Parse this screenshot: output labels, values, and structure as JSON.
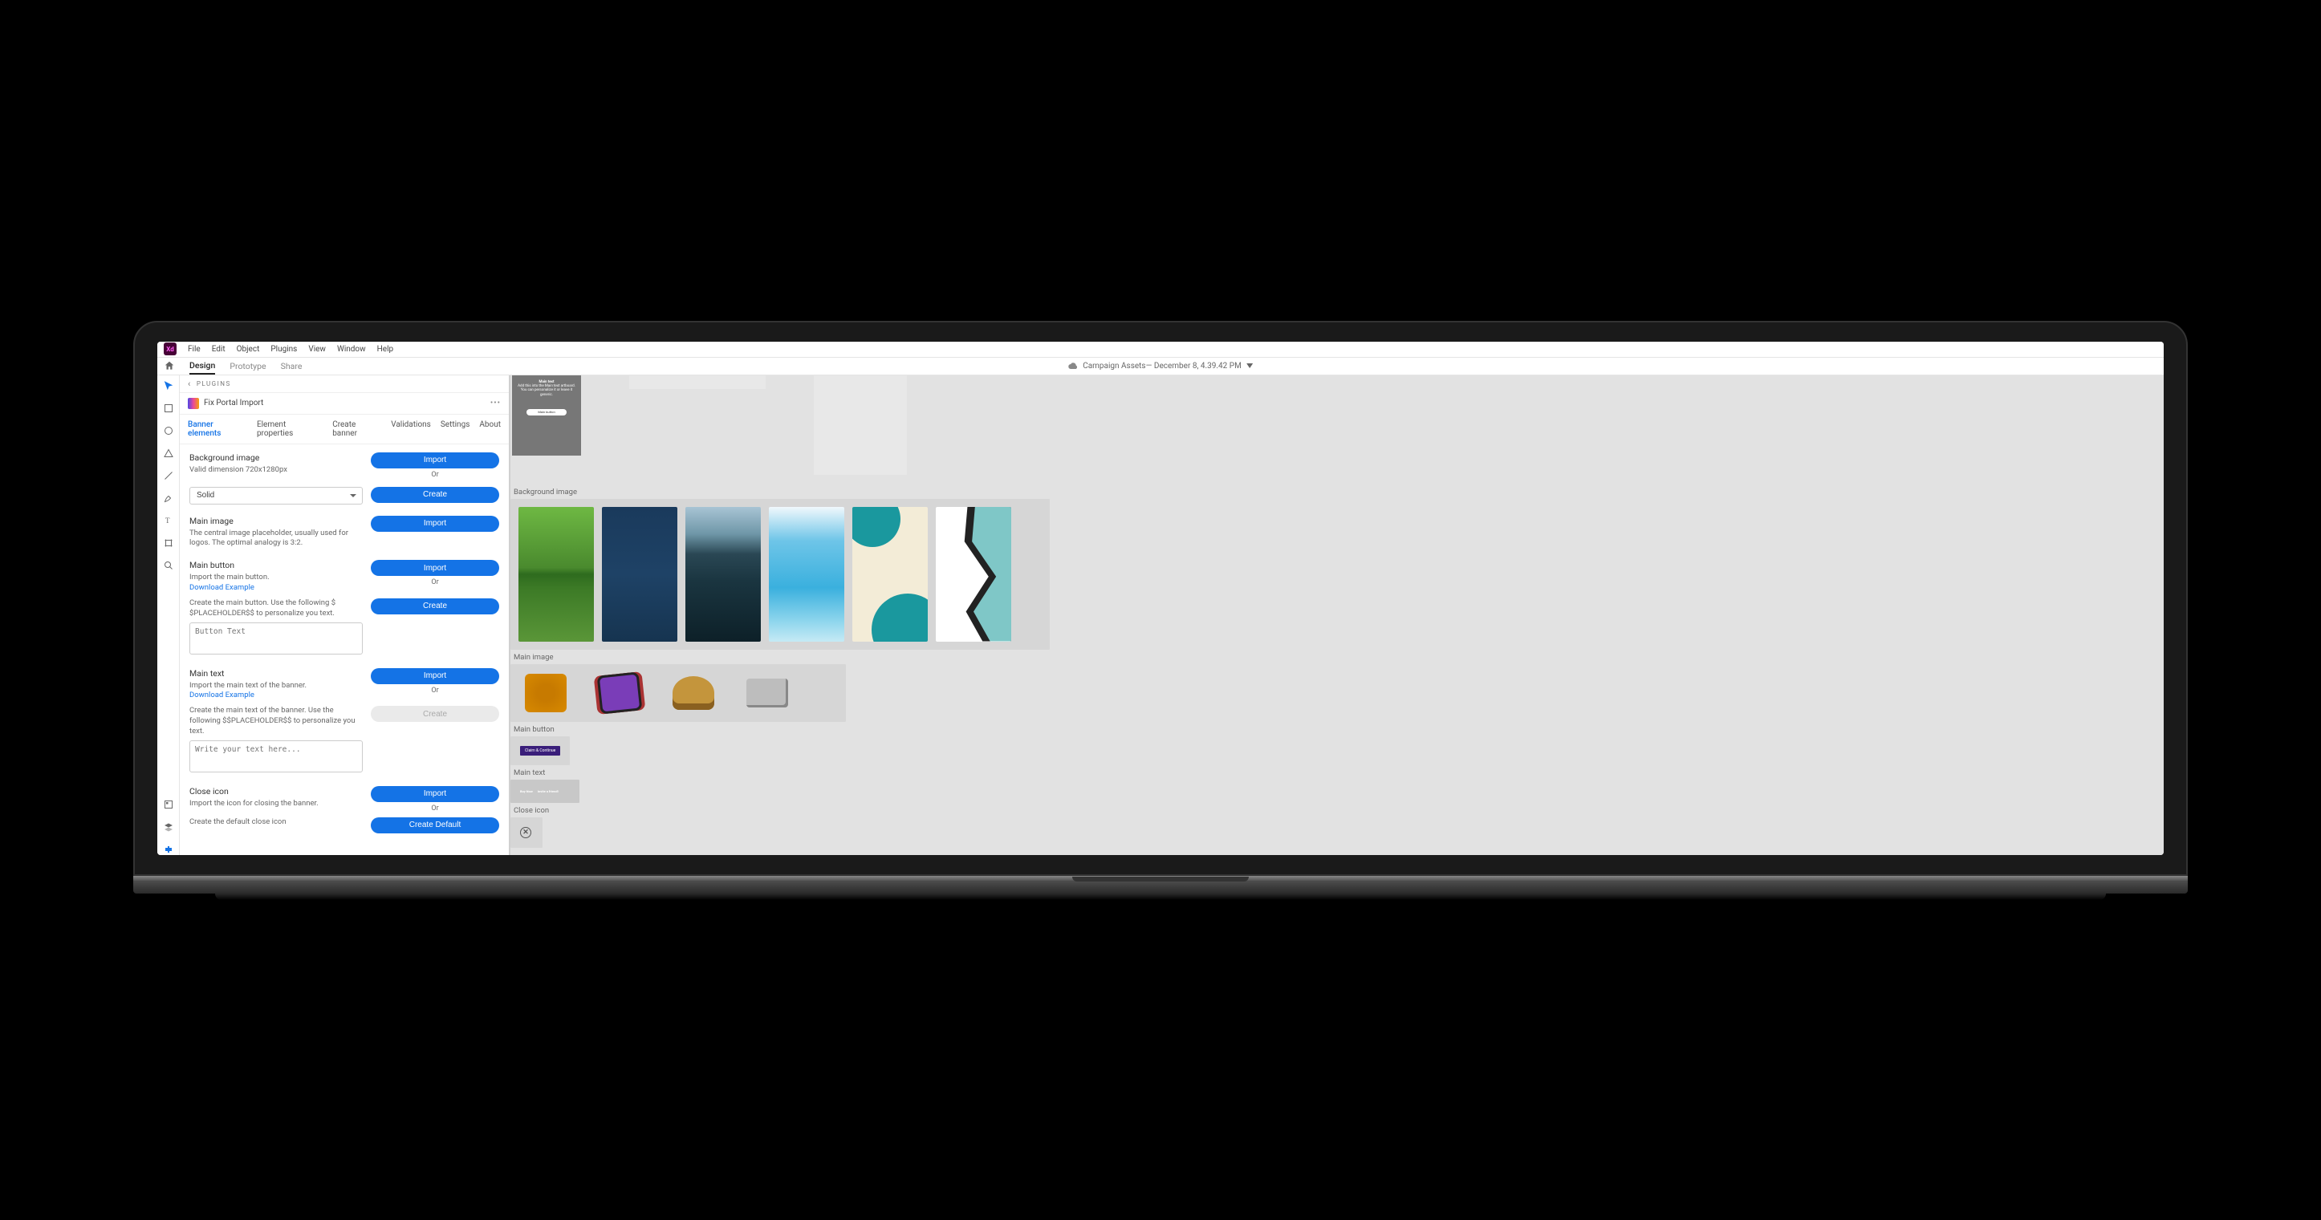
{
  "xd_badge": "Xd",
  "menubar": {
    "file": "File",
    "edit": "Edit",
    "object": "Object",
    "plugins": "Plugins",
    "view": "View",
    "window": "Window",
    "help": "Help"
  },
  "subbar": {
    "design": "Design",
    "prototype": "Prototype",
    "share": "Share"
  },
  "document": {
    "title": "Campaign Assets— December 8, 4.39.42 PM"
  },
  "plugins_header": "PLUGINS",
  "plugin_name": "Fix Portal Import",
  "plugin_tabs": {
    "banner": "Banner elements",
    "props": "Element properties",
    "create": "Create banner",
    "valid": "Validations",
    "settings": "Settings",
    "about": "About"
  },
  "sections": {
    "bg": {
      "label": "Background image",
      "desc": "Valid dimension 720x1280px",
      "import": "Import",
      "or": "Or",
      "create": "Create",
      "fill_option": "Solid"
    },
    "mainimg": {
      "label": "Main image",
      "desc": "The central image placeholder, usually used for logos. The optimal analogy is 3:2.",
      "import": "Import"
    },
    "mainbtn": {
      "label": "Main button",
      "desc": "Import the main button.",
      "link": "Download Example",
      "import": "Import",
      "or": "Or",
      "create": "Create",
      "create_desc": "Create the main button. Use the following $ $PLACEHOLDER$$ to personalize you text.",
      "placeholder": "Button Text"
    },
    "maintext": {
      "label": "Main text",
      "desc": "Import the main text of the banner.",
      "link": "Download Example",
      "import": "Import",
      "or": "Or",
      "create": "Create",
      "create_desc": "Create the main text of the banner. Use the following $$PLACEHOLDER$$ to personalize you text.",
      "placeholder": "Write your text here..."
    },
    "closeicon": {
      "label": "Close icon",
      "desc": "Import the icon for closing the banner.",
      "import": "Import",
      "or": "Or",
      "create_default": "Create Default",
      "create_desc": "Create the default close icon"
    }
  },
  "canvas": {
    "phone_main_title": "Main text",
    "phone_main_sub": "Add this into the Main text artboard. You can personalize it or leave it generic.",
    "phone_btn": "Main button",
    "labels": {
      "bg": "Background image",
      "mainimg": "Main image",
      "mainbtn": "Main button",
      "maintext": "Main text",
      "closeicon": "Close icon"
    },
    "claim_btn": "Claim & Continue",
    "mt1": "Buy Now",
    "mt2": "Invite a friend!"
  }
}
